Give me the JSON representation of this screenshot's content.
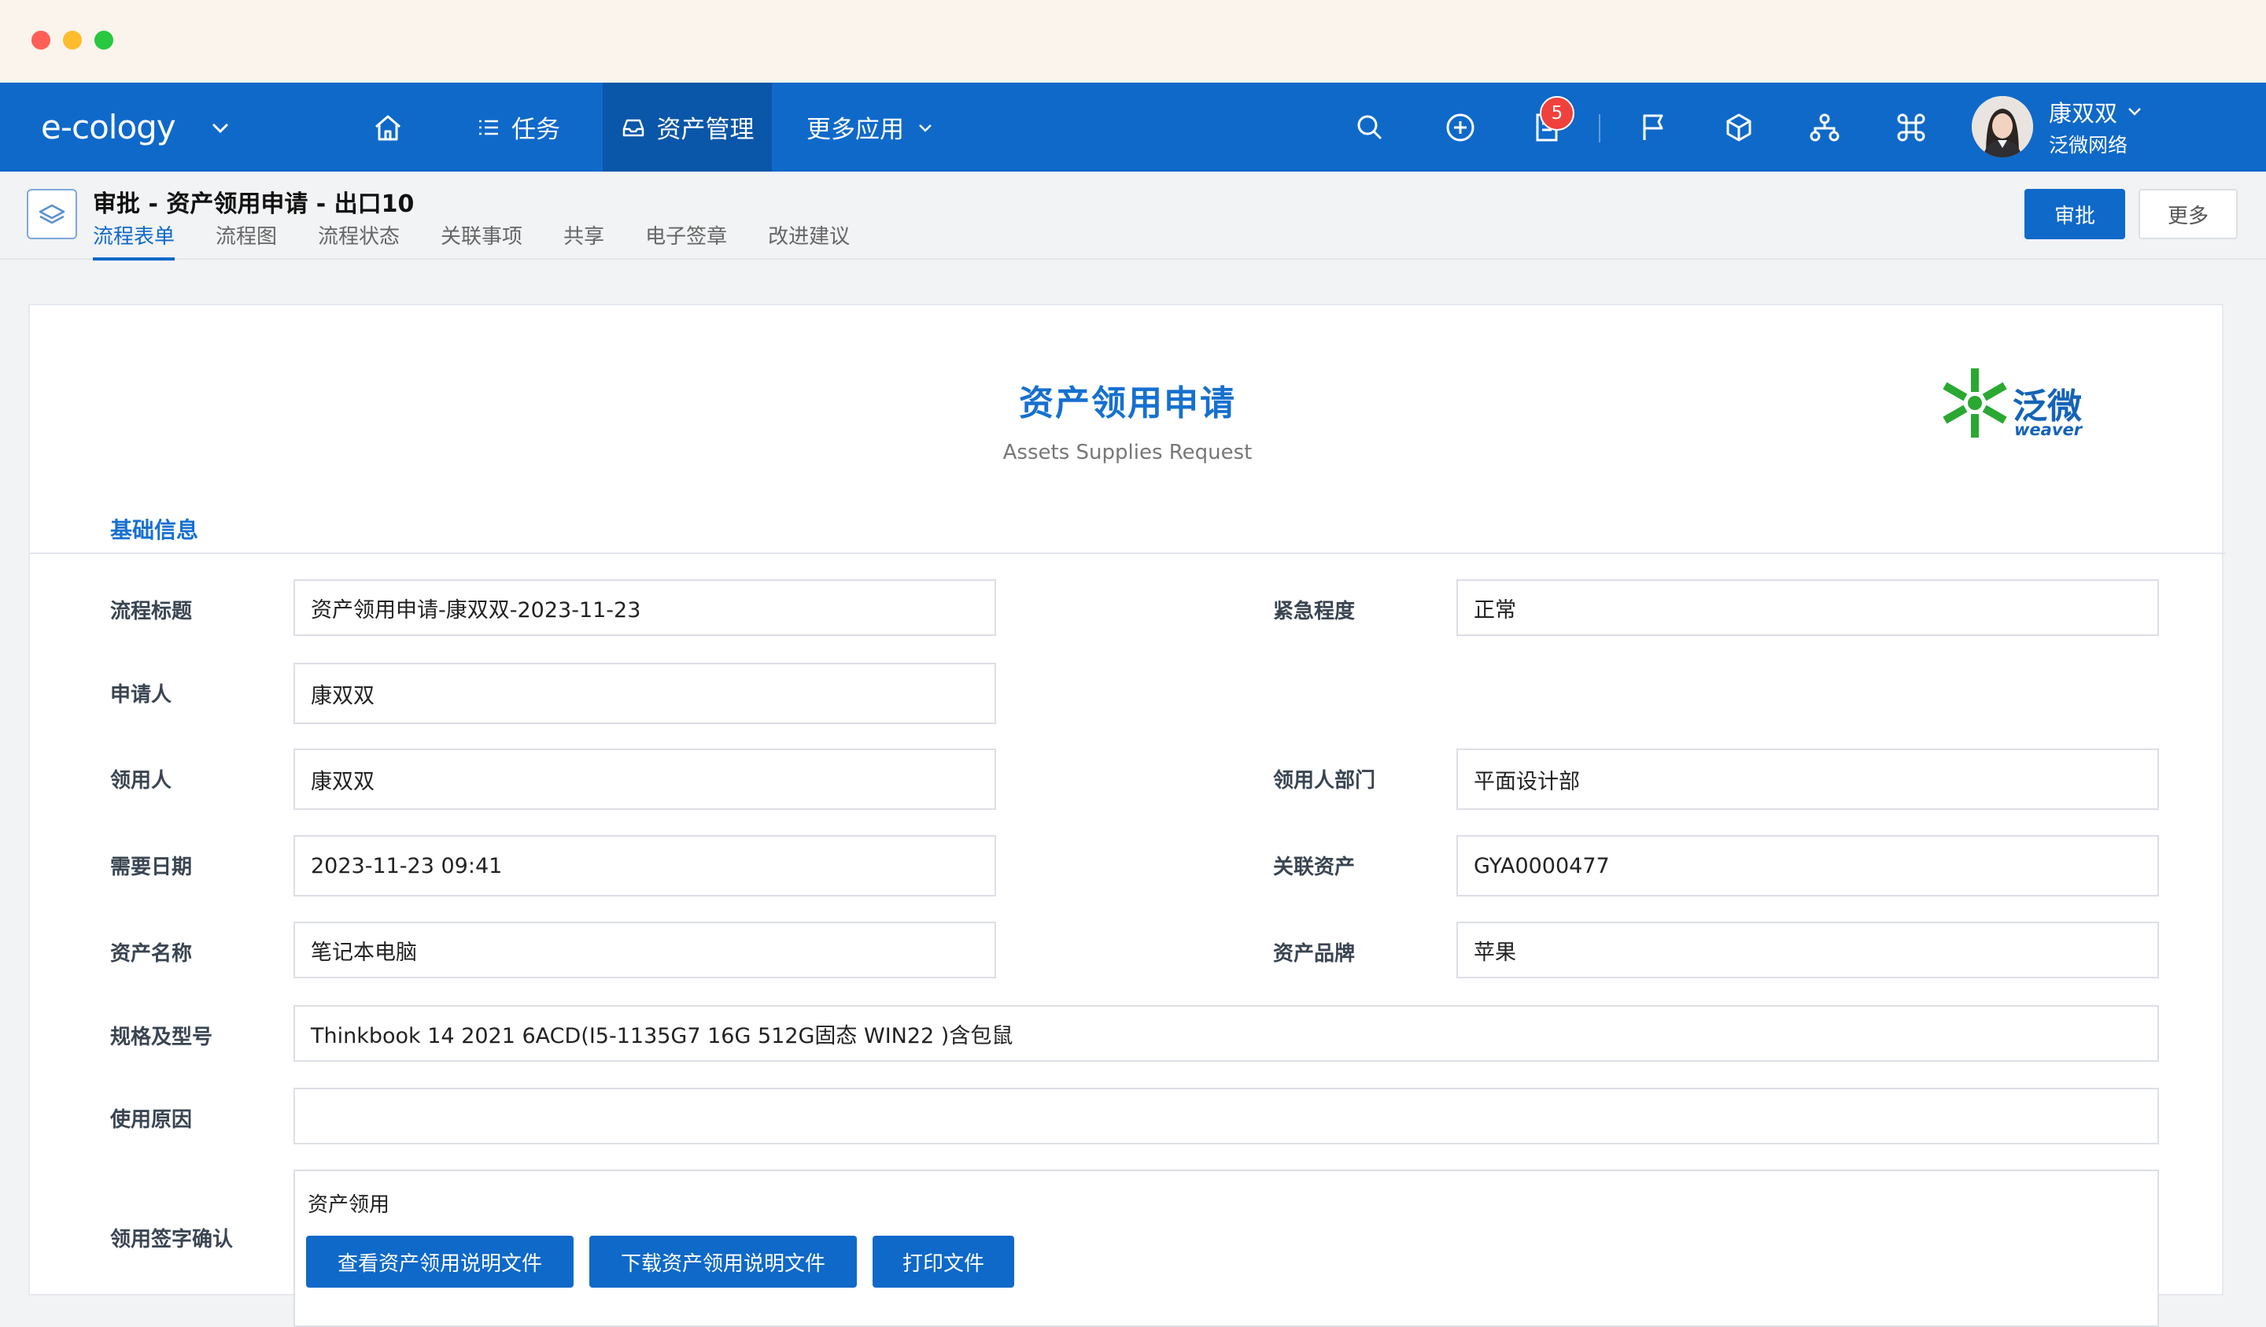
{
  "window": {
    "controls": [
      "close",
      "minimize",
      "maximize"
    ]
  },
  "topnav": {
    "brand": "e-cology",
    "items": [
      {
        "label": "",
        "icon": "home-icon"
      },
      {
        "label": "任务",
        "icon": "list-icon"
      },
      {
        "label": "资产管理",
        "icon": "inbox-icon",
        "active": true
      },
      {
        "label": "更多应用",
        "icon": "chevron-down-icon"
      }
    ],
    "notification_count": "5",
    "user": {
      "name": "康双双",
      "org": "泛微网络"
    }
  },
  "page": {
    "title": "审批 - 资产领用申请 - 出口10",
    "tabs": [
      "流程表单",
      "流程图",
      "流程状态",
      "关联事项",
      "共享",
      "电子签章",
      "改进建议"
    ],
    "active_tab": "流程表单",
    "approve_button": "审批",
    "more_button": "更多"
  },
  "form": {
    "title": "资产领用申请",
    "subtitle": "Assets Supplies Request",
    "logo": {
      "cn": "泛微",
      "en": "weaver"
    },
    "section": "基础信息",
    "fields": {
      "workflow_title": {
        "label": "流程标题",
        "value": "资产领用申请-康双双-2023-11-23"
      },
      "urgency": {
        "label": "紧急程度",
        "value": "正常"
      },
      "applicant": {
        "label": "申请人",
        "value": "康双双"
      },
      "recipient": {
        "label": "领用人",
        "value": "康双双"
      },
      "recipient_dept": {
        "label": "领用人部门",
        "value": "平面设计部"
      },
      "required_date": {
        "label": "需要日期",
        "value": "2023-11-23 09:41"
      },
      "related_asset": {
        "label": "关联资产",
        "value": "GYA0000477"
      },
      "asset_name": {
        "label": "资产名称",
        "value": "笔记本电脑"
      },
      "asset_brand": {
        "label": "资产品牌",
        "value": "苹果"
      },
      "spec_model": {
        "label": "规格及型号",
        "value": "Thinkbook 14 2021 6ACD(I5-1135G7 16G 512G固态 WIN22 )含包鼠"
      },
      "reason": {
        "label": "使用原因",
        "value": ""
      },
      "signature": {
        "label": "领用签字确认",
        "text": "资产领用",
        "buttons": [
          "查看资产领用说明文件",
          "下载资产领用说明文件",
          "打印文件"
        ]
      }
    }
  },
  "colors": {
    "primary": "#0f69c9",
    "nav_active": "#0a56a8",
    "badge": "#f0413c",
    "logo_green": "#2aa832"
  }
}
